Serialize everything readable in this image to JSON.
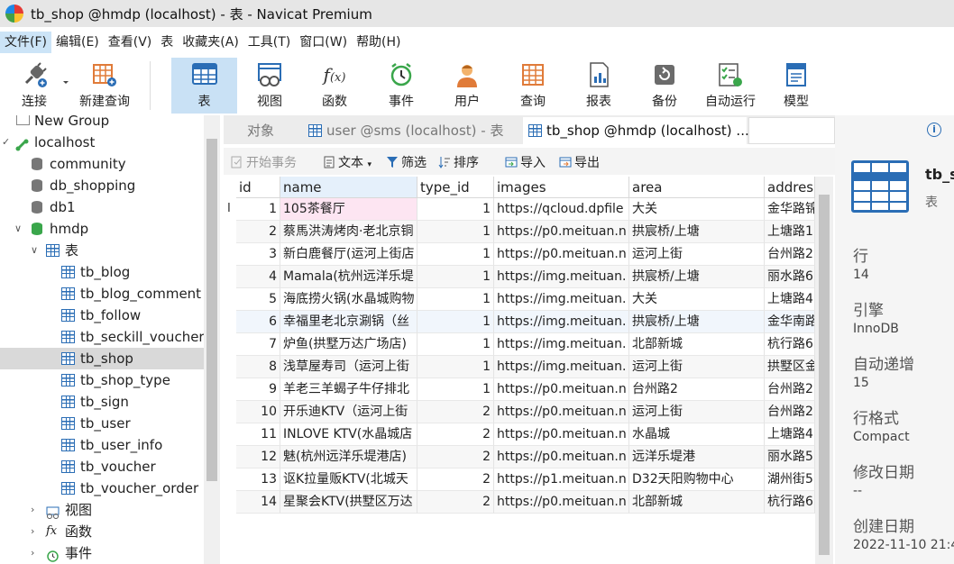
{
  "window": {
    "title": "tb_shop @hmdp (localhost) - 表 - Navicat Premium"
  },
  "menu": [
    "文件(F)",
    "编辑(E)",
    "查看(V)",
    "表",
    "收藏夹(A)",
    "工具(T)",
    "窗口(W)",
    "帮助(H)"
  ],
  "toolbar": {
    "connect": "连接",
    "new_query": "新建查询",
    "table": "表",
    "view": "视图",
    "function": "函数",
    "event": "事件",
    "user": "用户",
    "query": "查询",
    "report": "报表",
    "backup": "备份",
    "automation": "自动运行",
    "model": "模型"
  },
  "navigator": {
    "new_group": "New Group",
    "connection": "localhost",
    "databases": [
      "community",
      "db_shopping",
      "db1"
    ],
    "active_db": "hmdp",
    "tables_folder": "表",
    "tables": [
      "tb_blog",
      "tb_blog_comment",
      "tb_follow",
      "tb_seckill_voucher",
      "tb_shop",
      "tb_shop_type",
      "tb_sign",
      "tb_user",
      "tb_user_info",
      "tb_voucher",
      "tb_voucher_order"
    ],
    "views_folder": "视图",
    "functions_folder": "函数",
    "events_folder": "事件"
  },
  "tabs": [
    "对象",
    "user @sms (localhost) - 表",
    "tb_shop @hmdp (localhost) ..."
  ],
  "object_toolbar": {
    "begin_tx": "开始事务",
    "text": "文本",
    "filter": "筛选",
    "sort": "排序",
    "import": "导入",
    "export": "导出"
  },
  "grid": {
    "columns": [
      "id",
      "name",
      "type_id",
      "images",
      "area",
      "addres"
    ],
    "rows": [
      [
        "1",
        "105茶餐厅",
        "1",
        "https://qcloud.dpfile",
        "大关",
        "金华路锦"
      ],
      [
        "2",
        "蔡馬洪涛烤肉·老北京铜",
        "1",
        "https://p0.meituan.n",
        "拱宸桥/上塘",
        "上塘路1"
      ],
      [
        "3",
        "新白鹿餐厅(运河上街店",
        "1",
        "https://p0.meituan.n",
        "运河上街",
        "台州路2"
      ],
      [
        "4",
        "Mamala(杭州远洋乐堤",
        "1",
        "https://img.meituan.",
        "拱宸桥/上塘",
        "丽水路6"
      ],
      [
        "5",
        "海底捞火锅(水晶城购物",
        "1",
        "https://img.meituan.",
        "大关",
        "上塘路4"
      ],
      [
        "6",
        "幸福里老北京涮锅（丝",
        "1",
        "https://img.meituan.",
        "拱宸桥/上塘",
        "金华南路"
      ],
      [
        "7",
        "炉鱼(拱墅万达广场店)",
        "1",
        "https://img.meituan.",
        "北部新城",
        "杭行路6"
      ],
      [
        "8",
        "浅草屋寿司（运河上街",
        "1",
        "https://img.meituan.",
        "运河上街",
        "拱墅区金"
      ],
      [
        "9",
        "羊老三羊蝎子牛仔排北",
        "1",
        "https://p0.meituan.n",
        "台州路2",
        "台州路2"
      ],
      [
        "10",
        "开乐迪KTV（运河上街",
        "2",
        "https://p0.meituan.n",
        "运河上街",
        "台州路2"
      ],
      [
        "11",
        "INLOVE KTV(水晶城店",
        "2",
        "https://p0.meituan.n",
        "水晶城",
        "上塘路4"
      ],
      [
        "12",
        "魅(杭州远洋乐堤港店)",
        "2",
        "https://p0.meituan.n",
        "远洋乐堤港",
        "丽水路5"
      ],
      [
        "13",
        "讴K拉量贩KTV(北城天",
        "2",
        "https://p1.meituan.n",
        "D32天阳购物中心",
        "湖州街5"
      ],
      [
        "14",
        "星聚会KTV(拱墅区万达",
        "2",
        "https://p0.meituan.n",
        "北部新城",
        "杭行路6"
      ]
    ]
  },
  "info_panel": {
    "title": "tb_s",
    "subtitle": "表",
    "rows_label": "行",
    "rows_value": "14",
    "engine_label": "引擎",
    "engine_value": "InnoDB",
    "autoinc_label": "自动递增",
    "autoinc_value": "15",
    "rowformat_label": "行格式",
    "rowformat_value": "Compact",
    "modified_label": "修改日期",
    "modified_value": "--",
    "created_label": "创建日期",
    "created_value": "2022-11-10 21:4"
  },
  "colors": {
    "accent": "#2a6db5",
    "selected_toolbar": "#c9e1f5",
    "cursor_cell": "#fde5f2"
  }
}
